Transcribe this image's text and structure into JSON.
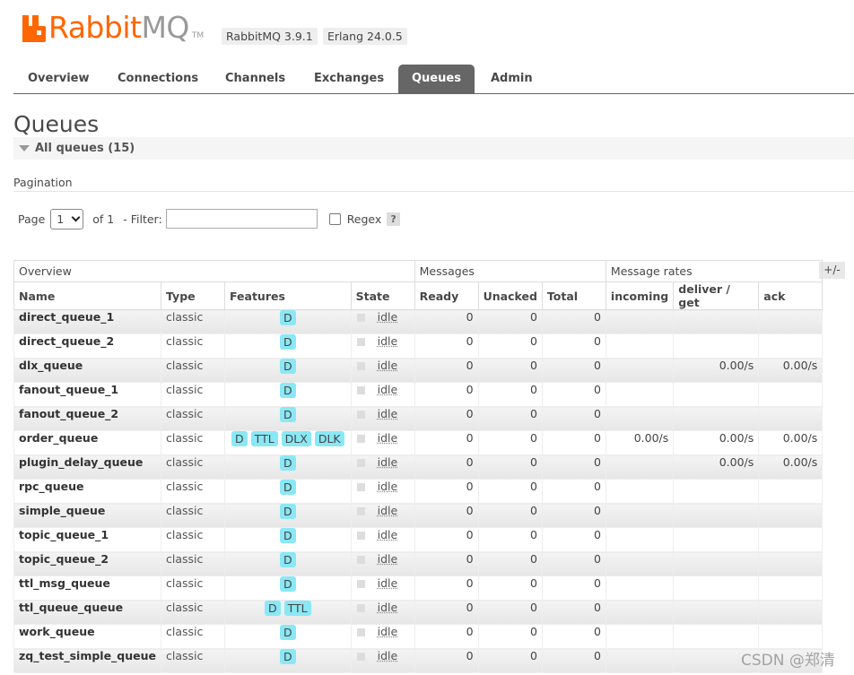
{
  "header": {
    "logo": {
      "brand_orange": "Rabbit",
      "brand_gray": "MQ",
      "tm": "TM"
    },
    "versions": [
      "RabbitMQ 3.9.1",
      "Erlang 24.0.5"
    ]
  },
  "tabs": [
    {
      "label": "Overview",
      "active": false
    },
    {
      "label": "Connections",
      "active": false
    },
    {
      "label": "Channels",
      "active": false
    },
    {
      "label": "Exchanges",
      "active": false
    },
    {
      "label": "Queues",
      "active": true
    },
    {
      "label": "Admin",
      "active": false
    }
  ],
  "page": {
    "title": "Queues",
    "section_label": "All queues (15)"
  },
  "pagination": {
    "label": "Pagination",
    "page_label": "Page",
    "page_value": "1",
    "of_label": "of 1",
    "filter_label": "- Filter:",
    "filter_value": "",
    "regex_label": "Regex",
    "help": "?"
  },
  "table": {
    "groups": [
      "Overview",
      "Messages",
      "Message rates"
    ],
    "toggle": "+/-",
    "columns": [
      "Name",
      "Type",
      "Features",
      "State",
      "Ready",
      "Unacked",
      "Total",
      "incoming",
      "deliver / get",
      "ack"
    ],
    "rows": [
      {
        "name": "direct_queue_1",
        "type": "classic",
        "features": [
          "D"
        ],
        "state": "idle",
        "ready": "0",
        "unacked": "0",
        "total": "0",
        "incoming": "",
        "deliver": "",
        "ack": ""
      },
      {
        "name": "direct_queue_2",
        "type": "classic",
        "features": [
          "D"
        ],
        "state": "idle",
        "ready": "0",
        "unacked": "0",
        "total": "0",
        "incoming": "",
        "deliver": "",
        "ack": ""
      },
      {
        "name": "dlx_queue",
        "type": "classic",
        "features": [
          "D"
        ],
        "state": "idle",
        "ready": "0",
        "unacked": "0",
        "total": "0",
        "incoming": "",
        "deliver": "0.00/s",
        "ack": "0.00/s"
      },
      {
        "name": "fanout_queue_1",
        "type": "classic",
        "features": [
          "D"
        ],
        "state": "idle",
        "ready": "0",
        "unacked": "0",
        "total": "0",
        "incoming": "",
        "deliver": "",
        "ack": ""
      },
      {
        "name": "fanout_queue_2",
        "type": "classic",
        "features": [
          "D"
        ],
        "state": "idle",
        "ready": "0",
        "unacked": "0",
        "total": "0",
        "incoming": "",
        "deliver": "",
        "ack": ""
      },
      {
        "name": "order_queue",
        "type": "classic",
        "features": [
          "D",
          "TTL",
          "DLX",
          "DLK"
        ],
        "state": "idle",
        "ready": "0",
        "unacked": "0",
        "total": "0",
        "incoming": "0.00/s",
        "deliver": "0.00/s",
        "ack": "0.00/s"
      },
      {
        "name": "plugin_delay_queue",
        "type": "classic",
        "features": [
          "D"
        ],
        "state": "idle",
        "ready": "0",
        "unacked": "0",
        "total": "0",
        "incoming": "",
        "deliver": "0.00/s",
        "ack": "0.00/s"
      },
      {
        "name": "rpc_queue",
        "type": "classic",
        "features": [
          "D"
        ],
        "state": "idle",
        "ready": "0",
        "unacked": "0",
        "total": "0",
        "incoming": "",
        "deliver": "",
        "ack": ""
      },
      {
        "name": "simple_queue",
        "type": "classic",
        "features": [
          "D"
        ],
        "state": "idle",
        "ready": "0",
        "unacked": "0",
        "total": "0",
        "incoming": "",
        "deliver": "",
        "ack": ""
      },
      {
        "name": "topic_queue_1",
        "type": "classic",
        "features": [
          "D"
        ],
        "state": "idle",
        "ready": "0",
        "unacked": "0",
        "total": "0",
        "incoming": "",
        "deliver": "",
        "ack": ""
      },
      {
        "name": "topic_queue_2",
        "type": "classic",
        "features": [
          "D"
        ],
        "state": "idle",
        "ready": "0",
        "unacked": "0",
        "total": "0",
        "incoming": "",
        "deliver": "",
        "ack": ""
      },
      {
        "name": "ttl_msg_queue",
        "type": "classic",
        "features": [
          "D"
        ],
        "state": "idle",
        "ready": "0",
        "unacked": "0",
        "total": "0",
        "incoming": "",
        "deliver": "",
        "ack": ""
      },
      {
        "name": "ttl_queue_queue",
        "type": "classic",
        "features": [
          "D",
          "TTL"
        ],
        "state": "idle",
        "ready": "0",
        "unacked": "0",
        "total": "0",
        "incoming": "",
        "deliver": "",
        "ack": ""
      },
      {
        "name": "work_queue",
        "type": "classic",
        "features": [
          "D"
        ],
        "state": "idle",
        "ready": "0",
        "unacked": "0",
        "total": "0",
        "incoming": "",
        "deliver": "",
        "ack": ""
      },
      {
        "name": "zq_test_simple_queue",
        "type": "classic",
        "features": [
          "D"
        ],
        "state": "idle",
        "ready": "0",
        "unacked": "0",
        "total": "0",
        "incoming": "",
        "deliver": "",
        "ack": ""
      }
    ]
  },
  "watermark": "CSDN @郑清",
  "colors": {
    "brand": "#ff6600",
    "active_tab": "#666666",
    "feature_badge": "#8ae8f5"
  }
}
